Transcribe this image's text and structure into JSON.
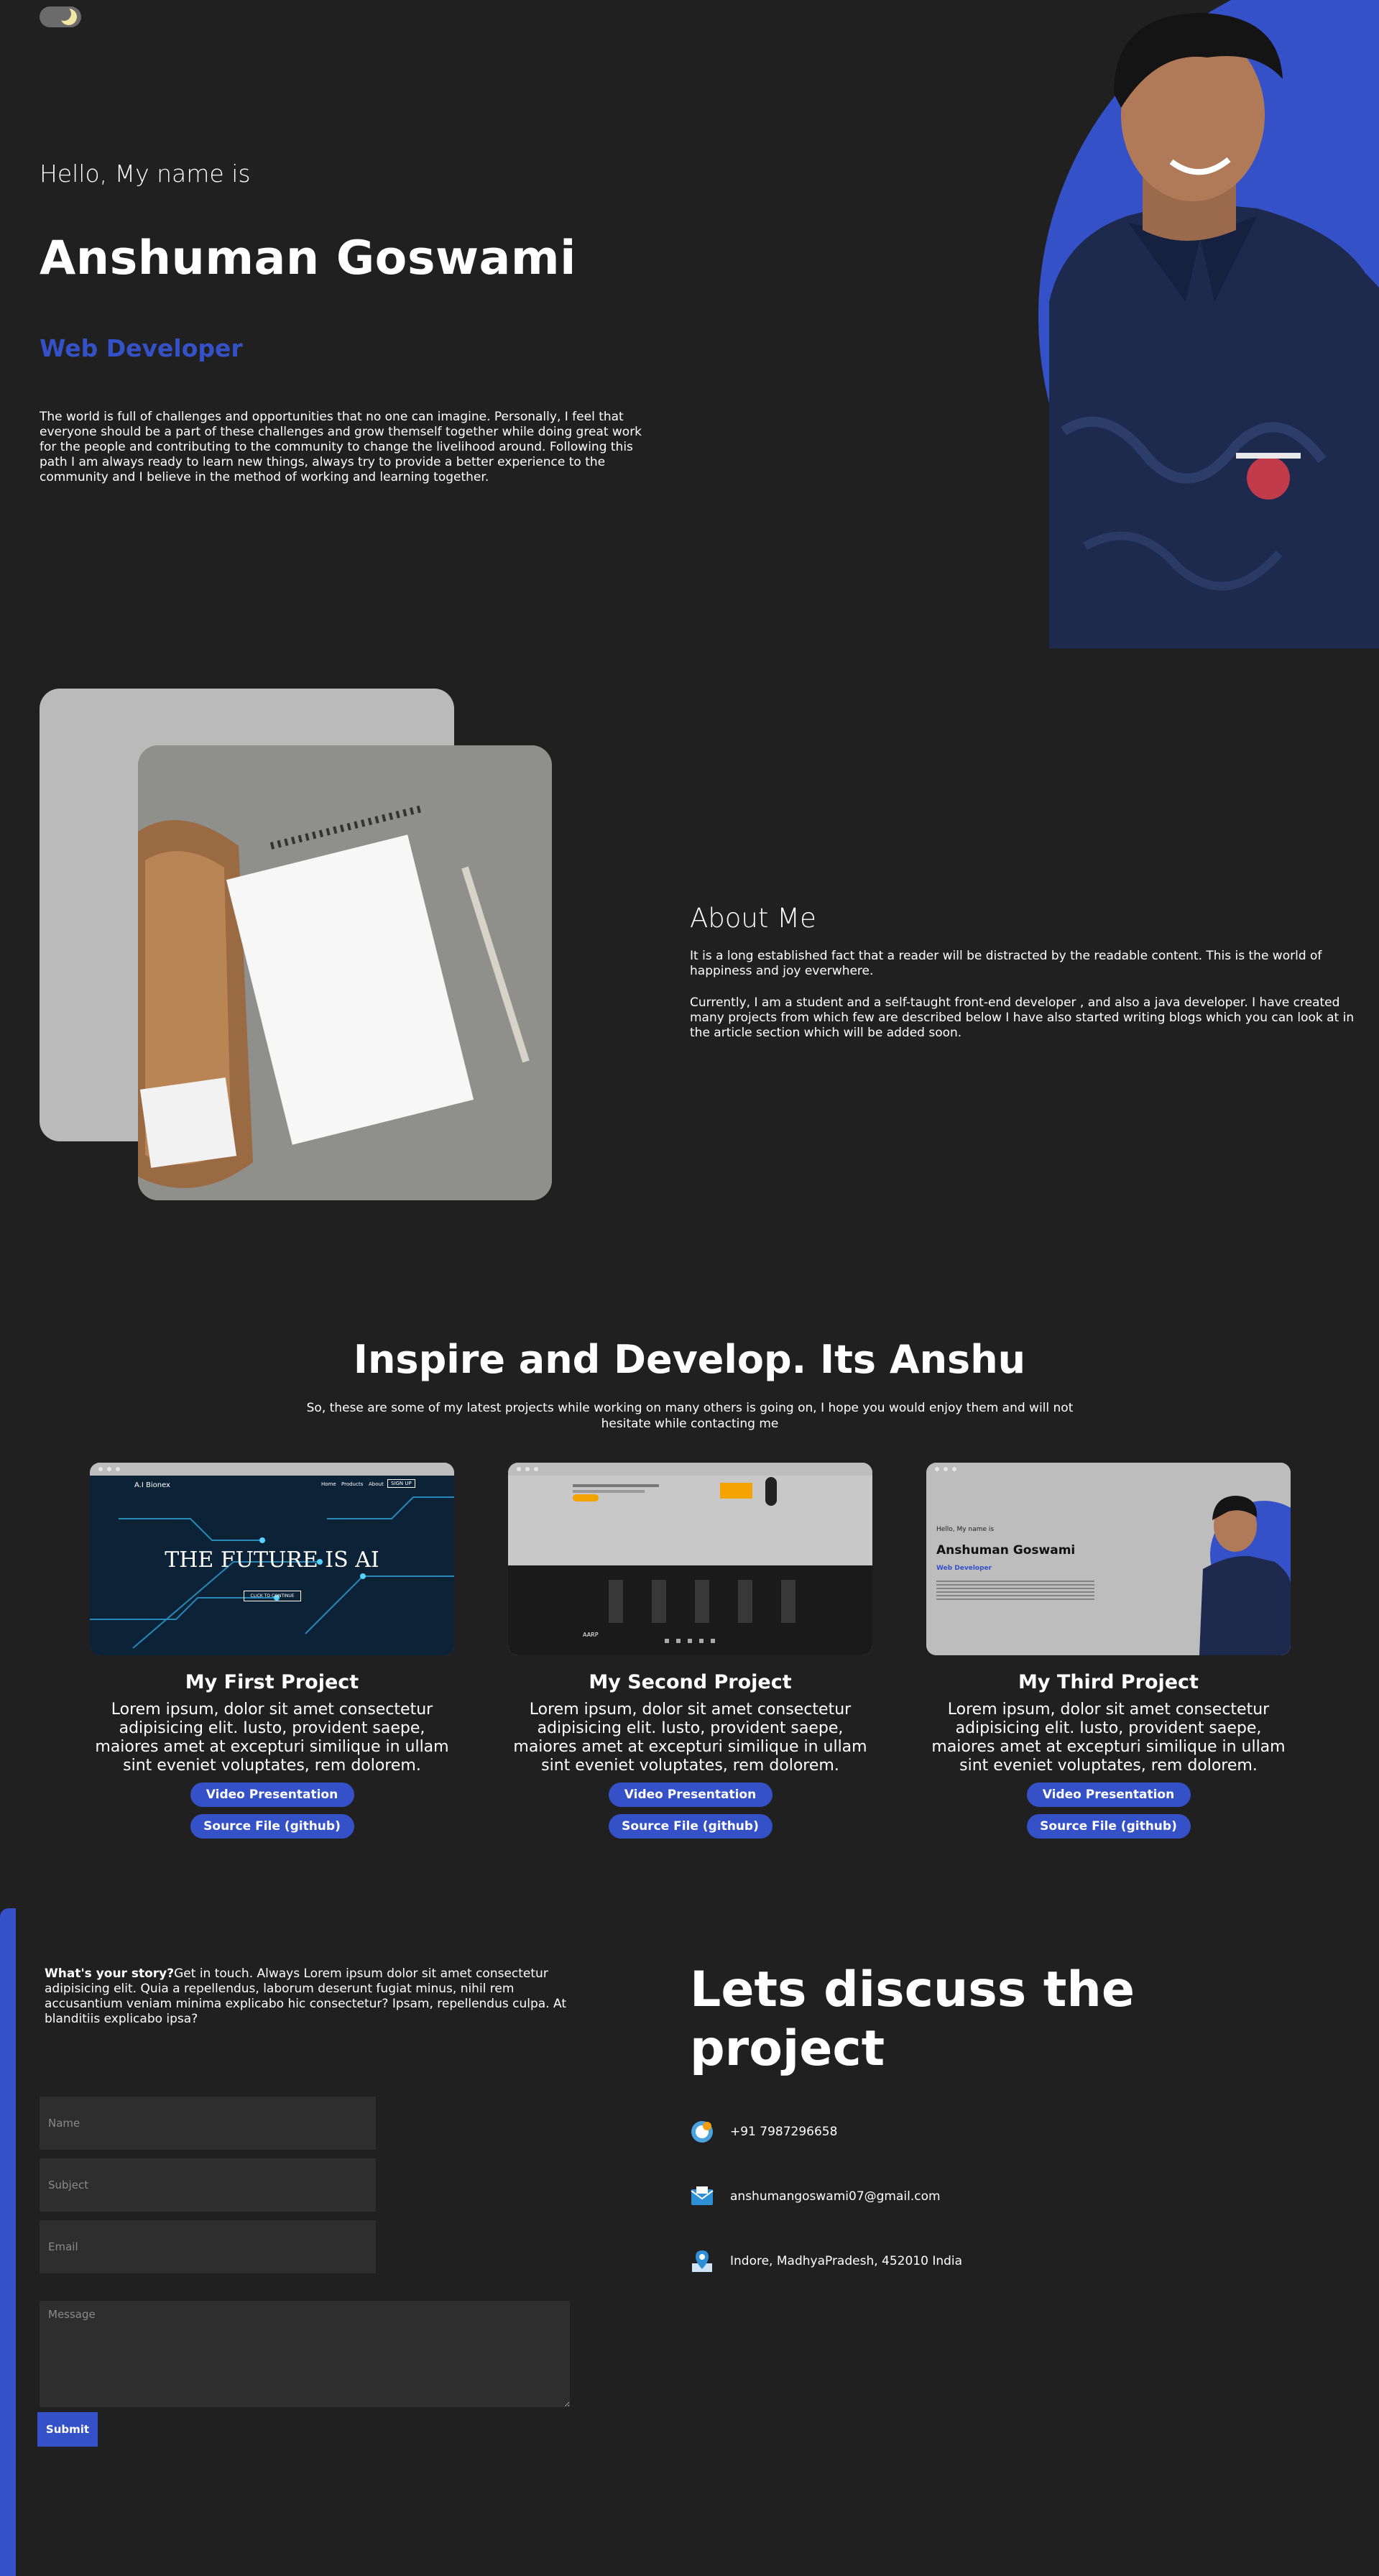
{
  "hero": {
    "greeting": "Hello, My name is",
    "name": "Anshuman Goswami",
    "role": "Web Developer",
    "intro": "The world is full of challenges and opportunities that no one can imagine. Personally, I feel that everyone should be a part of these challenges and grow themself together while doing great work for the people and contributing to the community to change the livelihood around. Following this path I am always ready to learn new things, always try to provide a better experience to the community and I believe in the method of working and learning together."
  },
  "about": {
    "title": "About Me",
    "p1": "It is a long established fact that a reader will be distracted by the readable content. This is the world of happiness and joy everwhere.",
    "p2": "Currently, I am a student and a self-taught front-end developer , and also a java developer. I have created many projects from which few are described below I have also started writing blogs which you can look at in the article section which will be added soon."
  },
  "projects": {
    "title": "Inspire and Develop. Its Anshu",
    "subtitle": "So, these are some of my latest projects while working on many others is going on, I hope you would enjoy them and will not hesitate while contacting me",
    "video_label": "Video Presentation",
    "source_label": "Source File (github)",
    "items": [
      {
        "title": "My First Project",
        "text": "Lorem ipsum, dolor sit amet consectetur adipisicing elit. Iusto, provident saepe, maiores amet at excepturi similique in ullam sint eveniet voluptates, rem dolorem.",
        "shot": {
          "brand": "A.I Bionex",
          "nav": [
            "Home",
            "Products",
            "About",
            "SIGN UP"
          ],
          "headline": "THE FUTURE IS AI",
          "cta": "CLICK TO CONTINUE"
        }
      },
      {
        "title": "My Second Project",
        "text": "Lorem ipsum, dolor sit amet consectetur adipisicing elit. Iusto, provident saepe, maiores amet at excepturi similique in ullam sint eveniet voluptates, rem dolorem.",
        "shot": {
          "brand": "AARP"
        }
      },
      {
        "title": "My Third Project",
        "text": "Lorem ipsum, dolor sit amet consectetur adipisicing elit. Iusto, provident saepe, maiores amet at excepturi similique in ullam sint eveniet voluptates, rem dolorem.",
        "shot": {
          "greeting": "Hello, My name is",
          "name": "Anshuman Goswami",
          "role": "Web Developer"
        }
      }
    ]
  },
  "contact": {
    "lead_bold": "What's your story?",
    "lead_text": "Get in touch. Always Lorem ipsum dolor sit amet consectetur adipisicing elit. Quia a repellendus, laborum deserunt fugiat minus, nihil rem accusantium veniam minima explicabo hic consectetur? Ipsam, repellendus culpa. At blanditiis explicabo ipsa?",
    "name_placeholder": "Name",
    "subject_placeholder": "Subject",
    "email_placeholder": "Email",
    "message_placeholder": "Message",
    "submit_label": "Submit",
    "heading": "Lets discuss the project",
    "phone": "+91 7987296658",
    "email": "anshumangoswami07@gmail.com",
    "address": "Indore, MadhyaPradesh, 452010 India",
    "icons": [
      "phone-icon",
      "mail-icon",
      "location-icon"
    ]
  },
  "colors": {
    "accent": "#3551c8",
    "background": "#202020",
    "field": "#2e2e2e"
  }
}
